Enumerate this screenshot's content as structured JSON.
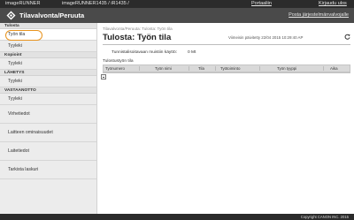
{
  "header": {
    "brand": "imageRUNNER",
    "model": "imageRUNNER1435 / iR1435 /",
    "portal_link": "Portaaliin",
    "login_link": "Kirjaudu ulos",
    "app_title": "Tilavalvonta/Peruuta",
    "portal_home_link": "Posta järjestelmänvalvojalle",
    "logo_icon": "canon-diamond-icon"
  },
  "sidebar": {
    "sections": [
      {
        "title": "Tulosta",
        "items": [
          "Työn tila",
          "Tyyleki"
        ]
      },
      {
        "title": "Kopioint",
        "items": [
          "Tyyleki"
        ]
      },
      {
        "title": "LÄHETYS",
        "items": [
          "Tyyleki"
        ]
      },
      {
        "title": "VASTAANOTTO",
        "items": [
          "Tyyleki"
        ]
      }
    ],
    "bottom_items": [
      "Virhetiedot",
      "Laitteen ominaisuudet",
      "Laitetiedot",
      "Tarkista laskuri"
    ],
    "selected": "Työn tila"
  },
  "main": {
    "breadcrumb": "Tilavalvonta/Peruuta: Tulosta: Työn tila",
    "title": "Tulosta: Työn tila",
    "last_updated": "Viimeisin päivitetty 22/04 2015 10:29:40 AP",
    "memory_label": "Tunnistalisoitavaan muistiin käyttö:",
    "memory_value": "0 Mt",
    "status_label": "Tulostustyön tila",
    "table_headers": [
      "Työnumero",
      "Työn nimi",
      "Tila",
      "Työtoiminto",
      "Työn tyyppi",
      "Aika"
    ],
    "refresh_icon": "refresh-icon",
    "expand_icon": "expand-icon"
  },
  "footer": {
    "copyright": "Copyright CANON INC. 2015"
  },
  "colors": {
    "topbar": "#2b2b2b",
    "titlebar": "#4a4a4a",
    "sidebar": "#ececec",
    "highlight": "#e8931e"
  }
}
